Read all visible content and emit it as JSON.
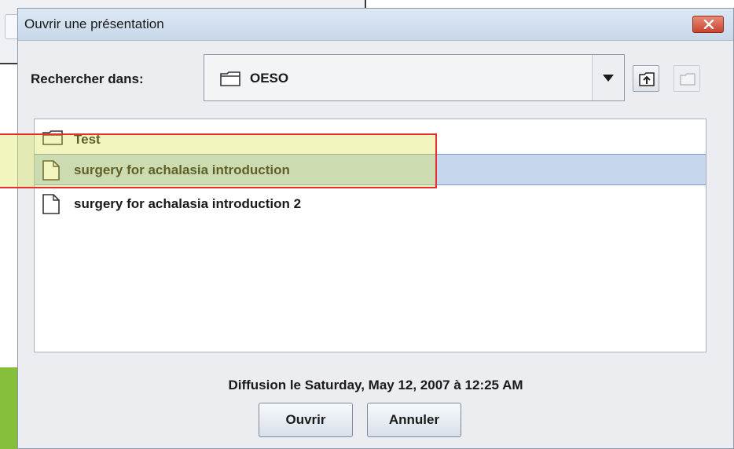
{
  "dialog": {
    "title": "Ouvrir une présentation",
    "look_in_label": "Rechercher dans:",
    "look_in_value": "OESO",
    "files": [
      {
        "name": "Test",
        "type": "folder",
        "selected": false
      },
      {
        "name": "surgery for achalasia introduction",
        "type": "file",
        "selected": true
      },
      {
        "name": "surgery for achalasia introduction 2",
        "type": "file",
        "selected": false
      }
    ],
    "status": "Diffusion le Saturday, May 12, 2007 à 12:25 AM",
    "open_label": "Ouvrir",
    "cancel_label": "Annuler"
  },
  "colors": {
    "selection": "#c6d6ec",
    "highlight_border": "#e52e2e",
    "close_button": "#c9442c"
  }
}
